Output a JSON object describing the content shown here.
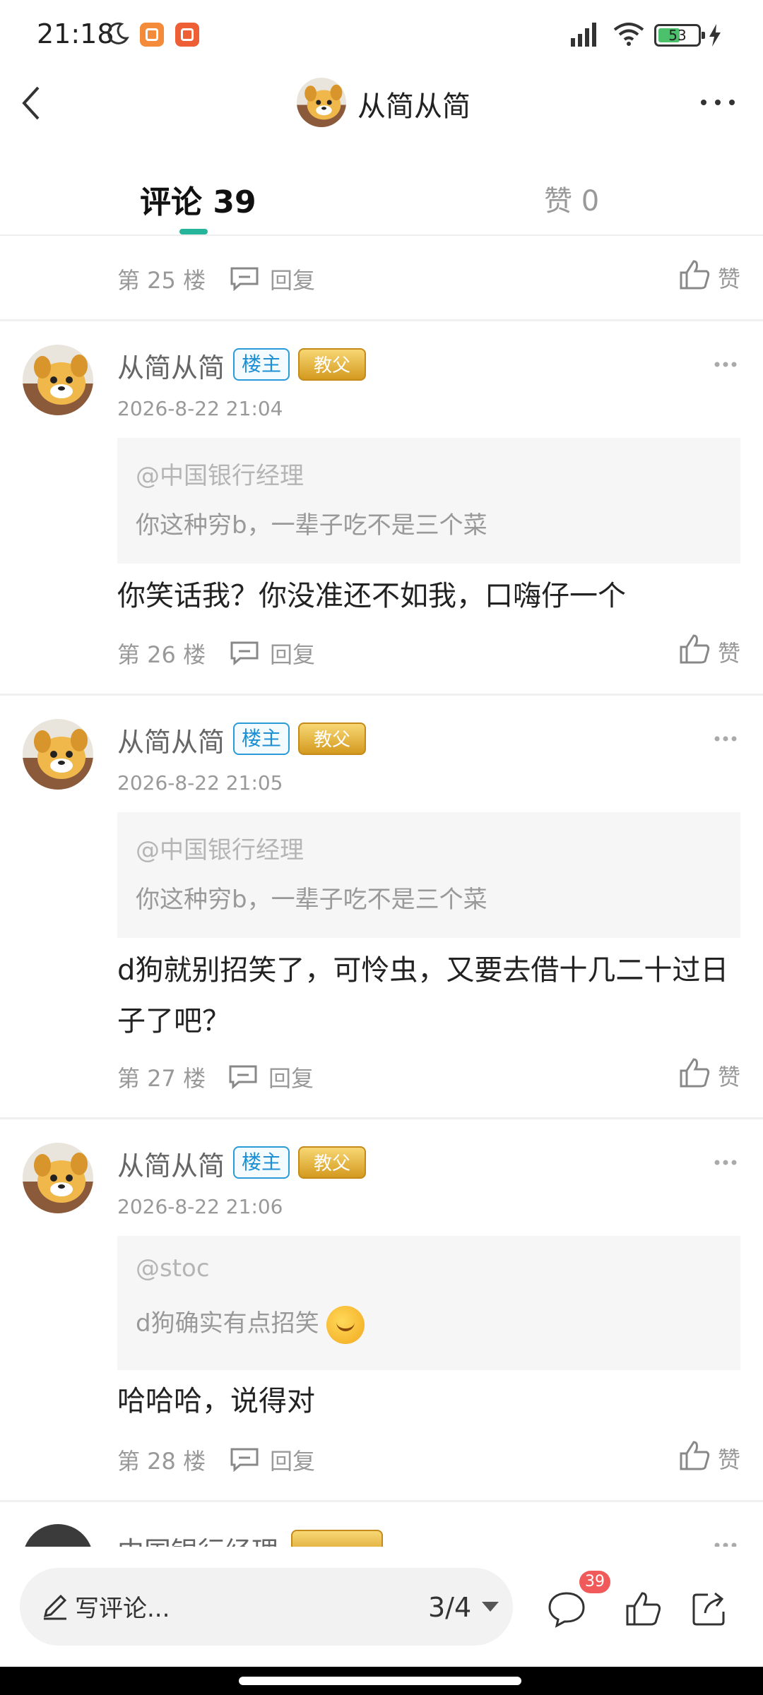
{
  "status_bar": {
    "time": "21:18",
    "battery": "53"
  },
  "header": {
    "title": "从简从简"
  },
  "tabs": {
    "comments_label": "评论",
    "comments_count": "39",
    "likes_label": "赞",
    "likes_count": "0"
  },
  "labels": {
    "reply": "回复",
    "like": "赞"
  },
  "top_partial": {
    "floor": "第 25 楼"
  },
  "comments": [
    {
      "username": "从简从简",
      "op_badge": "楼主",
      "title_badge": "教父",
      "timestamp": "2026-8-22 21:04",
      "quote_user": "@中国银行经理",
      "quote_text": "你这种穷b，一辈子吃不是三个菜",
      "text": "你笑话我？你没准还不如我，口嗨仔一个",
      "floor": "第 26 楼"
    },
    {
      "username": "从简从简",
      "op_badge": "楼主",
      "title_badge": "教父",
      "timestamp": "2026-8-22 21:05",
      "quote_user": "@中国银行经理",
      "quote_text": "你这种穷b，一辈子吃不是三个菜",
      "text": "d狗就别招笑了，可怜虫，又要去借十几二十过日子了吧？",
      "floor": "第 27 楼"
    },
    {
      "username": "从简从简",
      "op_badge": "楼主",
      "title_badge": "教父",
      "timestamp": "2026-8-22 21:06",
      "quote_user": "@stoc",
      "quote_text": "d狗确实有点招笑",
      "text": "哈哈哈，说得对",
      "floor": "第 28 楼"
    }
  ],
  "partial_next": {
    "username": "中国银行经理"
  },
  "bottom_bar": {
    "input_placeholder": "写评论...",
    "page_indicator": "3/4",
    "comment_badge": "39"
  },
  "colors": {
    "accent": "#26b59a",
    "op_badge": "#1f8fd3",
    "notify_badge": "#f05a5a"
  },
  "icons": [
    "back-icon",
    "more-icon",
    "reply-icon",
    "like-icon",
    "pencil-icon",
    "comment-icon",
    "share-icon"
  ]
}
